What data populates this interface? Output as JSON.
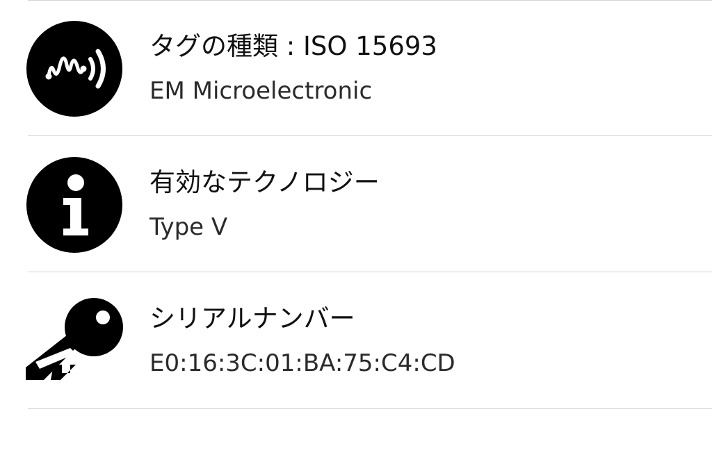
{
  "rows": [
    {
      "icon": "nfc-wave-icon",
      "title": "タグの種類 : ISO 15693",
      "value": "EM Microelectronic"
    },
    {
      "icon": "info-icon",
      "title": "有効なテクノロジー",
      "value": "Type V"
    },
    {
      "icon": "key-icon",
      "title": "シリアルナンバー",
      "value": "E0:16:3C:01:BA:75:C4:CD"
    }
  ],
  "colors": {
    "text": "#111111",
    "secondary_text": "#2a2a2a",
    "divider": "#d4d4d4",
    "icon_fill": "#000000",
    "background": "#ffffff"
  }
}
